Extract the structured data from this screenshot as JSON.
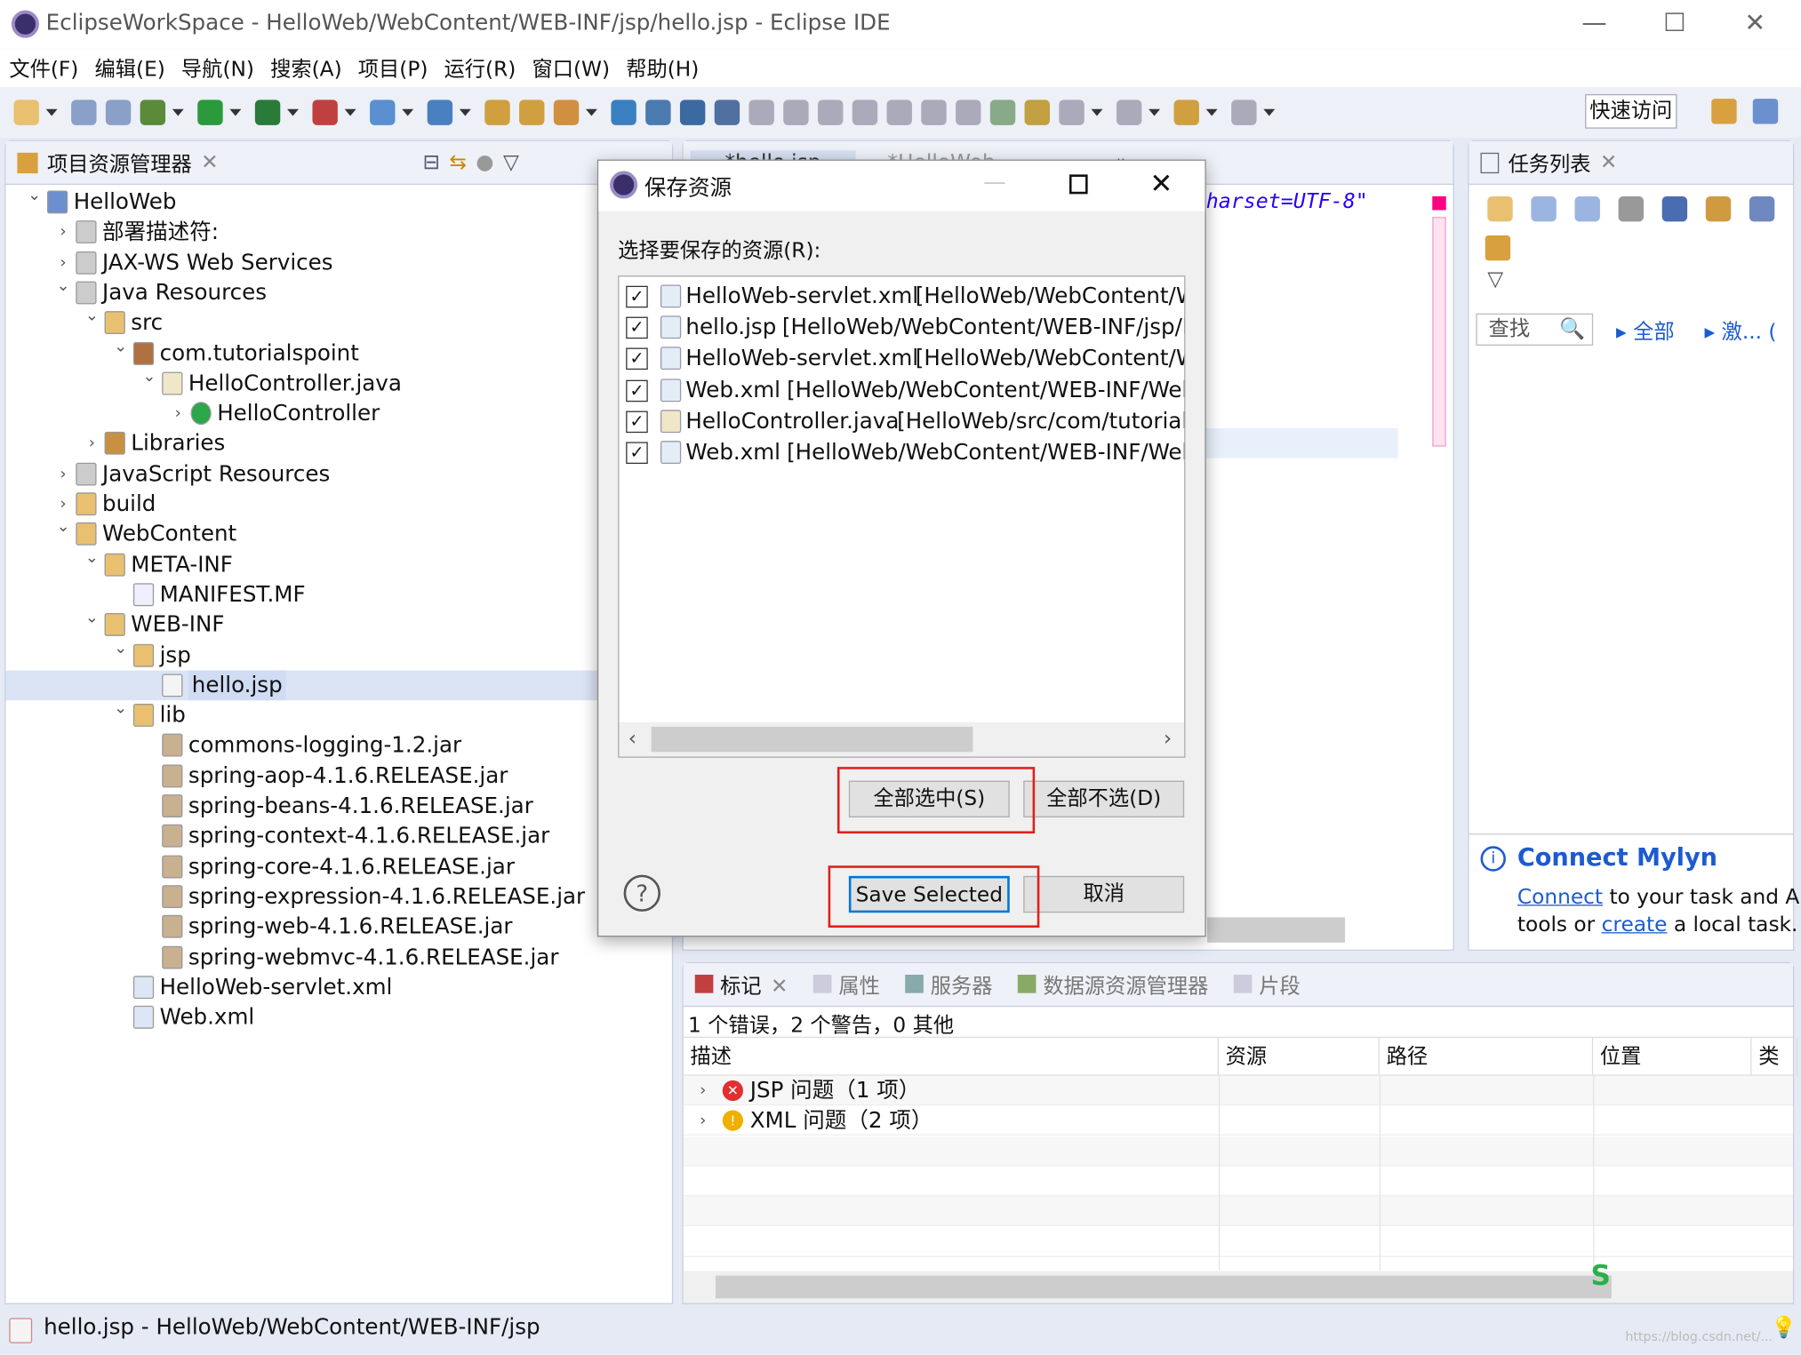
{
  "window": {
    "title": "EclipseWorkSpace - HelloWeb/WebContent/WEB-INF/jsp/hello.jsp - Eclipse IDE",
    "minimize": "—",
    "maximize": "☐",
    "close": "✕"
  },
  "menu": [
    "文件(F)",
    "编辑(E)",
    "导航(N)",
    "搜索(A)",
    "项目(P)",
    "运行(R)",
    "窗口(W)",
    "帮助(H)"
  ],
  "toolbar": {
    "icons": [
      "new-icon",
      "save-icon",
      "save-all-icon",
      "debug-icon",
      "run-icon",
      "coverage-icon",
      "external-tools-icon",
      "new-server-icon",
      "new-class-icon",
      "open-type-icon",
      "open-folder-icon",
      "pen-icon",
      "globe-icon",
      "search-icon",
      "console-icon",
      "skip-breakpoints-icon",
      "resume-icon",
      "suspend-icon",
      "terminate-icon",
      "disconnect-icon",
      "step-into-icon",
      "step-over-icon",
      "step-return-icon",
      "annotation-icon",
      "annotation-next-icon",
      "next-annotation-icon",
      "prev-annotation-icon",
      "back-icon",
      "forward-icon"
    ],
    "quick_access": "快速访问"
  },
  "explorer": {
    "title": "项目资源管理器",
    "tree": [
      {
        "label": "HelloWeb",
        "level": 0,
        "state": "open",
        "icon": "project-icon"
      },
      {
        "label": "部署描述符:",
        "level": 1,
        "state": "closed",
        "icon": "deployment-descriptor-icon"
      },
      {
        "label": "JAX-WS Web Services",
        "level": 1,
        "state": "closed",
        "icon": "web-services-icon"
      },
      {
        "label": "Java Resources",
        "level": 1,
        "state": "open",
        "icon": "java-resources-icon"
      },
      {
        "label": "src",
        "level": 2,
        "state": "open",
        "icon": "source-folder-icon"
      },
      {
        "label": "com.tutorialspoint",
        "level": 3,
        "state": "open",
        "icon": "package-icon"
      },
      {
        "label": "HelloController.java",
        "level": 4,
        "state": "open",
        "icon": "java-file-icon"
      },
      {
        "label": "HelloController",
        "level": 5,
        "state": "closed",
        "icon": "class-icon"
      },
      {
        "label": "Libraries",
        "level": 2,
        "state": "closed",
        "icon": "library-icon"
      },
      {
        "label": "JavaScript Resources",
        "level": 1,
        "state": "closed",
        "icon": "javascript-resources-icon"
      },
      {
        "label": "build",
        "level": 1,
        "state": "closed",
        "icon": "folder-icon"
      },
      {
        "label": "WebContent",
        "level": 1,
        "state": "open",
        "icon": "folder-error-icon"
      },
      {
        "label": "META-INF",
        "level": 2,
        "state": "open",
        "icon": "folder-icon"
      },
      {
        "label": "MANIFEST.MF",
        "level": 3,
        "state": "none",
        "icon": "text-file-icon"
      },
      {
        "label": "WEB-INF",
        "level": 2,
        "state": "open",
        "icon": "folder-error-icon"
      },
      {
        "label": "jsp",
        "level": 3,
        "state": "open",
        "icon": "folder-error-icon"
      },
      {
        "label": "hello.jsp",
        "level": 4,
        "state": "none",
        "icon": "jsp-file-error-icon",
        "selected": true
      },
      {
        "label": "lib",
        "level": 3,
        "state": "open",
        "icon": "folder-icon"
      },
      {
        "label": "commons-logging-1.2.jar",
        "level": 4,
        "state": "none",
        "icon": "jar-icon"
      },
      {
        "label": "spring-aop-4.1.6.RELEASE.jar",
        "level": 4,
        "state": "none",
        "icon": "jar-icon"
      },
      {
        "label": "spring-beans-4.1.6.RELEASE.jar",
        "level": 4,
        "state": "none",
        "icon": "jar-icon"
      },
      {
        "label": "spring-context-4.1.6.RELEASE.jar",
        "level": 4,
        "state": "none",
        "icon": "jar-icon"
      },
      {
        "label": "spring-core-4.1.6.RELEASE.jar",
        "level": 4,
        "state": "none",
        "icon": "jar-icon"
      },
      {
        "label": "spring-expression-4.1.6.RELEASE.jar",
        "level": 4,
        "state": "none",
        "icon": "jar-icon"
      },
      {
        "label": "spring-web-4.1.6.RELEASE.jar",
        "level": 4,
        "state": "none",
        "icon": "jar-icon"
      },
      {
        "label": "spring-webmvc-4.1.6.RELEASE.jar",
        "level": 4,
        "state": "none",
        "icon": "jar-icon"
      },
      {
        "label": "HelloWeb-servlet.xml",
        "level": 3,
        "state": "none",
        "icon": "xml-warning-icon"
      },
      {
        "label": "Web.xml",
        "level": 3,
        "state": "none",
        "icon": "xml-warning-icon"
      }
    ]
  },
  "editor": {
    "tabs": [
      "*hello.jsp",
      "*HelloWeb..."
    ],
    "overflow": "»",
    "code_fragment": "harset=UTF-8\""
  },
  "tasks": {
    "title": "任务列表",
    "find_placeholder": "查找",
    "all": "全部",
    "activate": "激...",
    "paren": "(",
    "mylyn": {
      "title": "Connect Mylyn",
      "connect": "Connect",
      "text1": " to your task and A",
      "text2a": "tools or ",
      "create": "create",
      "text2b": " a local task."
    }
  },
  "dialog": {
    "title": "保存资源",
    "prompt": "选择要保存的资源(R):",
    "items": [
      {
        "name": "HelloWeb-servlet.xml",
        "path": "[HelloWeb/WebContent/W",
        "checked": true,
        "icon": "xml-file-icon"
      },
      {
        "name": "hello.jsp",
        "path": "[HelloWeb/WebContent/WEB-INF/jsp/h",
        "checked": true,
        "icon": "jsp-file-icon"
      },
      {
        "name": "HelloWeb-servlet.xml",
        "path": "[HelloWeb/WebContent/W",
        "checked": true,
        "icon": "xml-file-icon"
      },
      {
        "name": "Web.xml",
        "path": "[HelloWeb/WebContent/WEB-INF/Web",
        "checked": true,
        "icon": "xml-file-icon"
      },
      {
        "name": "HelloController.java",
        "path": "[HelloWeb/src/com/tutorials",
        "checked": true,
        "icon": "java-file-icon"
      },
      {
        "name": "Web.xml",
        "path": "[HelloWeb/WebContent/WEB-INF/Web",
        "checked": true,
        "icon": "xml-file-icon"
      }
    ],
    "select_all": "全部选中(S)",
    "deselect_all": "全部不选(D)",
    "save_selected": "Save Selected",
    "cancel": "取消",
    "help": "?"
  },
  "problems": {
    "tabs": [
      "标记",
      "属性",
      "服务器",
      "数据源资源管理器",
      "片段"
    ],
    "summary": "1 个错误，2 个警告，0 其他",
    "columns": [
      "描述",
      "资源",
      "路径",
      "位置",
      "类型"
    ],
    "rows": [
      {
        "label": "JSP 问题（1 项）",
        "severity": "error"
      },
      {
        "label": "XML 问题（2 项）",
        "severity": "warning"
      }
    ]
  },
  "status": {
    "text": "hello.jsp - HelloWeb/WebContent/WEB-INF/jsp",
    "watermark": "https://blog.csdn.net/..."
  },
  "colors": {
    "highlight": "#e0201b",
    "link": "#1c5bd0",
    "selection": "#dbe4f5",
    "error": "#e03030",
    "warning": "#f0b000"
  }
}
